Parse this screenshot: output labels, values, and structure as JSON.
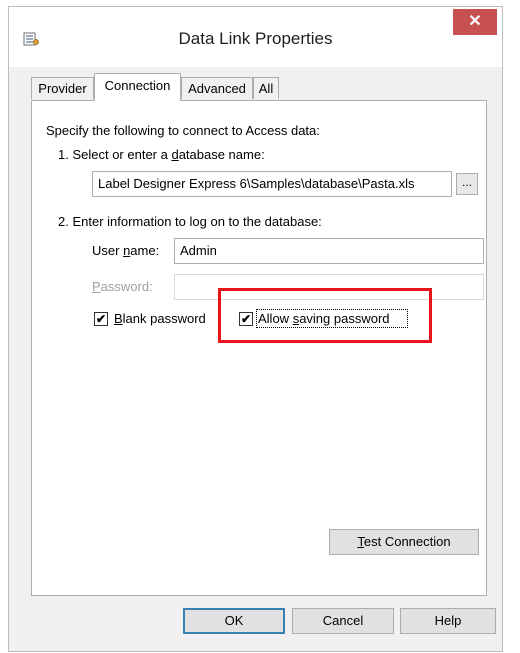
{
  "window": {
    "title": "Data Link Properties",
    "close_glyph": "✕"
  },
  "tabs": [
    {
      "label": "Provider",
      "active": false
    },
    {
      "label": "Connection",
      "active": true
    },
    {
      "label": "Advanced",
      "active": false
    },
    {
      "label": "All",
      "active": false
    }
  ],
  "connection": {
    "intro": "Specify the following to connect to Access data:",
    "step1_prefix": "1. Select or enter a ",
    "step1_underlined": "d",
    "step1_suffix": "atabase name:",
    "database_path": "Label Designer Express 6\\Samples\\database\\Pasta.xls",
    "browse_label": "...",
    "step2": "2. Enter information to log on to the database:",
    "username_prefix": "User ",
    "username_underlined": "n",
    "username_suffix": "ame:",
    "username_value": "Admin",
    "password_underlined": "P",
    "password_suffix": "assword:",
    "password_value": "",
    "blank_password_underlined": "B",
    "blank_password_suffix": "lank password",
    "blank_password_checked": "✔",
    "allow_saving_prefix": "Allow ",
    "allow_saving_underlined": "s",
    "allow_saving_suffix": "aving password",
    "allow_saving_checked": "✔",
    "test_connection_underlined": "T",
    "test_connection_suffix": "est Connection"
  },
  "footer": {
    "ok": "OK",
    "cancel": "Cancel",
    "help": "Help"
  },
  "colors": {
    "highlight": "#e8141c",
    "close_button": "#c75050"
  }
}
